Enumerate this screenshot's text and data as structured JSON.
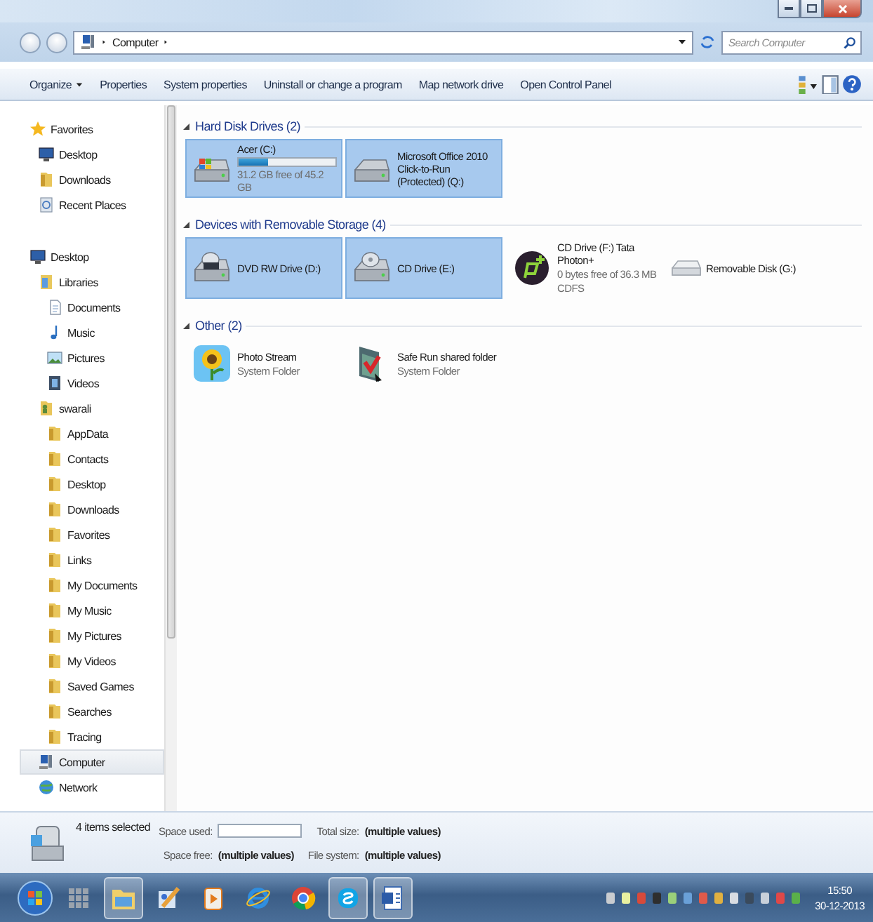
{
  "window": {
    "breadcrumb": "Computer",
    "search_placeholder": "Search Computer"
  },
  "toolbar": [
    {
      "label": "Organize",
      "dropdown": true
    },
    {
      "label": "Properties",
      "dropdown": false
    },
    {
      "label": "System properties",
      "dropdown": false
    },
    {
      "label": "Uninstall or change a program",
      "dropdown": false
    },
    {
      "label": "Map network drive",
      "dropdown": false
    },
    {
      "label": "Open Control Panel",
      "dropdown": false
    }
  ],
  "sidebar": {
    "sections": [
      {
        "label": "Favorites",
        "kind": "star",
        "selected": false,
        "children": [
          {
            "label": "Desktop",
            "kind": "monitor",
            "selected": false
          },
          {
            "label": "Downloads",
            "kind": "folder",
            "selected": false
          },
          {
            "label": "Recent Places",
            "kind": "recent",
            "selected": false
          }
        ]
      },
      {
        "label": "Desktop",
        "kind": "monitor",
        "selected": false,
        "children": [
          {
            "label": "Libraries",
            "kind": "library",
            "selected": false,
            "children": [
              {
                "label": "Documents",
                "kind": "document",
                "selected": false
              },
              {
                "label": "Music",
                "kind": "music",
                "selected": false
              },
              {
                "label": "Pictures",
                "kind": "picture",
                "selected": false
              },
              {
                "label": "Videos",
                "kind": "video",
                "selected": false
              }
            ]
          },
          {
            "label": "swarali",
            "kind": "user",
            "selected": false,
            "children": [
              {
                "label": "AppData",
                "kind": "folder",
                "selected": false
              },
              {
                "label": "Contacts",
                "kind": "folder",
                "selected": false
              },
              {
                "label": "Desktop",
                "kind": "folder",
                "selected": false
              },
              {
                "label": "Downloads",
                "kind": "folder",
                "selected": false
              },
              {
                "label": "Favorites",
                "kind": "folder",
                "selected": false
              },
              {
                "label": "Links",
                "kind": "folder",
                "selected": false
              },
              {
                "label": "My Documents",
                "kind": "folder",
                "selected": false
              },
              {
                "label": "My Music",
                "kind": "folder",
                "selected": false
              },
              {
                "label": "My Pictures",
                "kind": "folder",
                "selected": false
              },
              {
                "label": "My Videos",
                "kind": "folder",
                "selected": false
              },
              {
                "label": "Saved Games",
                "kind": "folder",
                "selected": false
              },
              {
                "label": "Searches",
                "kind": "folder",
                "selected": false
              },
              {
                "label": "Tracing",
                "kind": "folder",
                "selected": false
              }
            ]
          },
          {
            "label": "Computer",
            "kind": "computer",
            "selected": true
          },
          {
            "label": "Network",
            "kind": "network",
            "selected": false
          }
        ]
      }
    ]
  },
  "groups": [
    {
      "title": "Hard Disk Drives (2)",
      "expanded": true,
      "items": [
        {
          "kind": "system_drive",
          "name": "Acer (C:)",
          "level": 0.31,
          "lines": [
            "31.2 GB free of 45.2 GB"
          ],
          "selected": true
        },
        {
          "kind": "drive",
          "name": "Microsoft Office 2010 Click-to-Run (Protected) (Q:)",
          "selected": true
        }
      ]
    },
    {
      "title": "Devices with Removable Storage (4)",
      "expanded": true,
      "items": [
        {
          "kind": "dvd",
          "name": "DVD RW Drive (D:)",
          "selected": true
        },
        {
          "kind": "cd",
          "name": "CD Drive (E:)",
          "selected": true
        },
        {
          "kind": "modem",
          "name": "CD Drive (F:) Tata Photon+",
          "lines": [
            "0 bytes free of 36.3 MB",
            "CDFS"
          ],
          "selected": false
        },
        {
          "kind": "usb",
          "name": "Removable Disk (G:)",
          "selected": false
        }
      ]
    },
    {
      "title": "Other (2)",
      "expanded": true,
      "items": [
        {
          "kind": "photos",
          "name": "Photo Stream",
          "lines": [
            "System Folder"
          ],
          "selected": false
        },
        {
          "kind": "shared",
          "name": "Safe Run shared folder",
          "lines": [
            "System Folder"
          ],
          "selected": false
        }
      ]
    }
  ],
  "details": {
    "summary": "4 items selected",
    "fields": [
      {
        "label": "Space used:",
        "kind": "bar"
      },
      {
        "label": "Total size:",
        "value": "(multiple values)",
        "kind": "text"
      },
      {
        "label": "Space free:",
        "value": "(multiple values)",
        "kind": "text"
      },
      {
        "label": "File system:",
        "value": "(multiple values)",
        "kind": "text"
      }
    ]
  },
  "taskbar": {
    "apps": [
      {
        "kind": "games",
        "running": false
      },
      {
        "kind": "explorer",
        "running": true
      },
      {
        "kind": "paint",
        "running": false
      },
      {
        "kind": "media",
        "running": false
      },
      {
        "kind": "ie",
        "running": false
      },
      {
        "kind": "chrome",
        "running": false
      },
      {
        "kind": "skype",
        "running": true
      },
      {
        "kind": "word",
        "running": true
      }
    ],
    "time": "15:50",
    "date": "30-12-2013"
  }
}
